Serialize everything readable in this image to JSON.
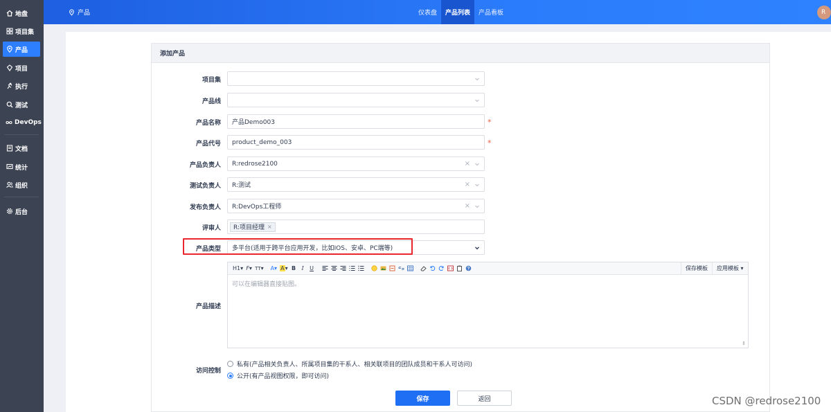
{
  "sidebar": {
    "items": [
      {
        "label": "地盘",
        "icon": "home-icon"
      },
      {
        "label": "项目集",
        "icon": "grid-icon"
      },
      {
        "label": "产品",
        "icon": "location-pin-icon"
      },
      {
        "label": "项目",
        "icon": "project-icon"
      },
      {
        "label": "执行",
        "icon": "run-icon"
      },
      {
        "label": "测试",
        "icon": "search-icon"
      },
      {
        "label": "DevOps",
        "icon": "infinity-icon"
      },
      {
        "label": "文档",
        "icon": "document-icon"
      },
      {
        "label": "统计",
        "icon": "chart-icon"
      },
      {
        "label": "组织",
        "icon": "users-icon"
      },
      {
        "label": "后台",
        "icon": "gear-icon"
      }
    ],
    "active": "产品"
  },
  "header": {
    "breadcrumb": "产品",
    "nav": [
      {
        "label": "仪表盘"
      },
      {
        "label": "产品列表"
      },
      {
        "label": "产品看板"
      }
    ],
    "nav_active": "产品列表",
    "avatar_initial": "R"
  },
  "form": {
    "title": "添加产品",
    "fields": {
      "program": {
        "label": "项目集",
        "value": ""
      },
      "line": {
        "label": "产品线",
        "value": ""
      },
      "name": {
        "label": "产品名称",
        "value": "产品Demo003",
        "required": "*"
      },
      "code": {
        "label": "产品代号",
        "value": "product_demo_003",
        "required": "*"
      },
      "po": {
        "label": "产品负责人",
        "value": "R:redrose2100"
      },
      "qd": {
        "label": "测试负责人",
        "value": "R:测试"
      },
      "rd": {
        "label": "发布负责人",
        "value": "R:DevOps工程师"
      },
      "reviewer": {
        "label": "评审人",
        "tag": "R:项目经理",
        "tag_remove": "×"
      },
      "type": {
        "label": "产品类型",
        "value": "多平台(适用于跨平台应用开发，比如IOS、安卓、PC端等)"
      },
      "desc": {
        "label": "产品描述",
        "placeholder": "可以在编辑器直接贴图。"
      },
      "acl": {
        "label": "访问控制",
        "options": [
          {
            "label": "私有(产品相关负责人、所属项目集的干系人、相关联项目的团队成员和干系人可访问)",
            "checked": false
          },
          {
            "label": "公开(有产品视图权限，即可访问)",
            "checked": true
          }
        ]
      }
    },
    "editor_toolbar": {
      "heading": "H1",
      "font": "F",
      "size": "TT",
      "bold": "B",
      "italic": "I",
      "underline": "U",
      "save_template": "保存模板",
      "apply_template": "应用模板"
    },
    "buttons": {
      "save": "保存",
      "back": "返回"
    }
  },
  "watermark": "CSDN @redrose2100",
  "colors": {
    "primary": "#2e7fff",
    "sidebar": "#3c4353",
    "highlight": "#e8262b",
    "required": "#ee5b40"
  }
}
